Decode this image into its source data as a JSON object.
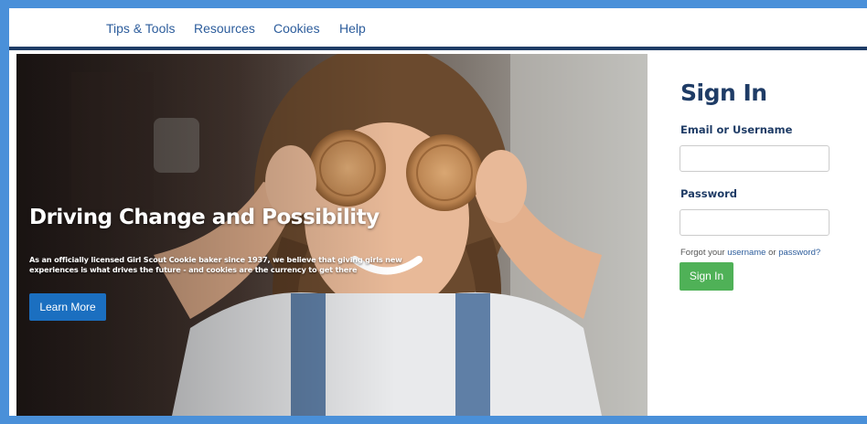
{
  "nav": {
    "items": [
      {
        "label": "Tips & Tools"
      },
      {
        "label": "Resources"
      },
      {
        "label": "Cookies"
      },
      {
        "label": "Help"
      }
    ]
  },
  "hero": {
    "title": "Driving Change and Possibility",
    "body": "As an officially licensed Girl Scout Cookie baker since 1937, we believe that giving girls new experiences is what drives the future - and cookies are the currency to get there",
    "button_label": "Learn More"
  },
  "signin": {
    "title": "Sign In",
    "email_label": "Email or Username",
    "email_value": "",
    "password_label": "Password",
    "password_value": "",
    "forgot_prefix": "Forgot your",
    "forgot_username": "username",
    "forgot_or": "or",
    "forgot_password": "password?",
    "button_label": "Sign In"
  },
  "colors": {
    "page_border": "#4a90d9",
    "nav_text": "#2d5d9c",
    "nav_rule": "#1f3c66",
    "heading": "#1f3c66",
    "hero_button": "#1b6fc0",
    "signin_button": "#4fb157"
  }
}
